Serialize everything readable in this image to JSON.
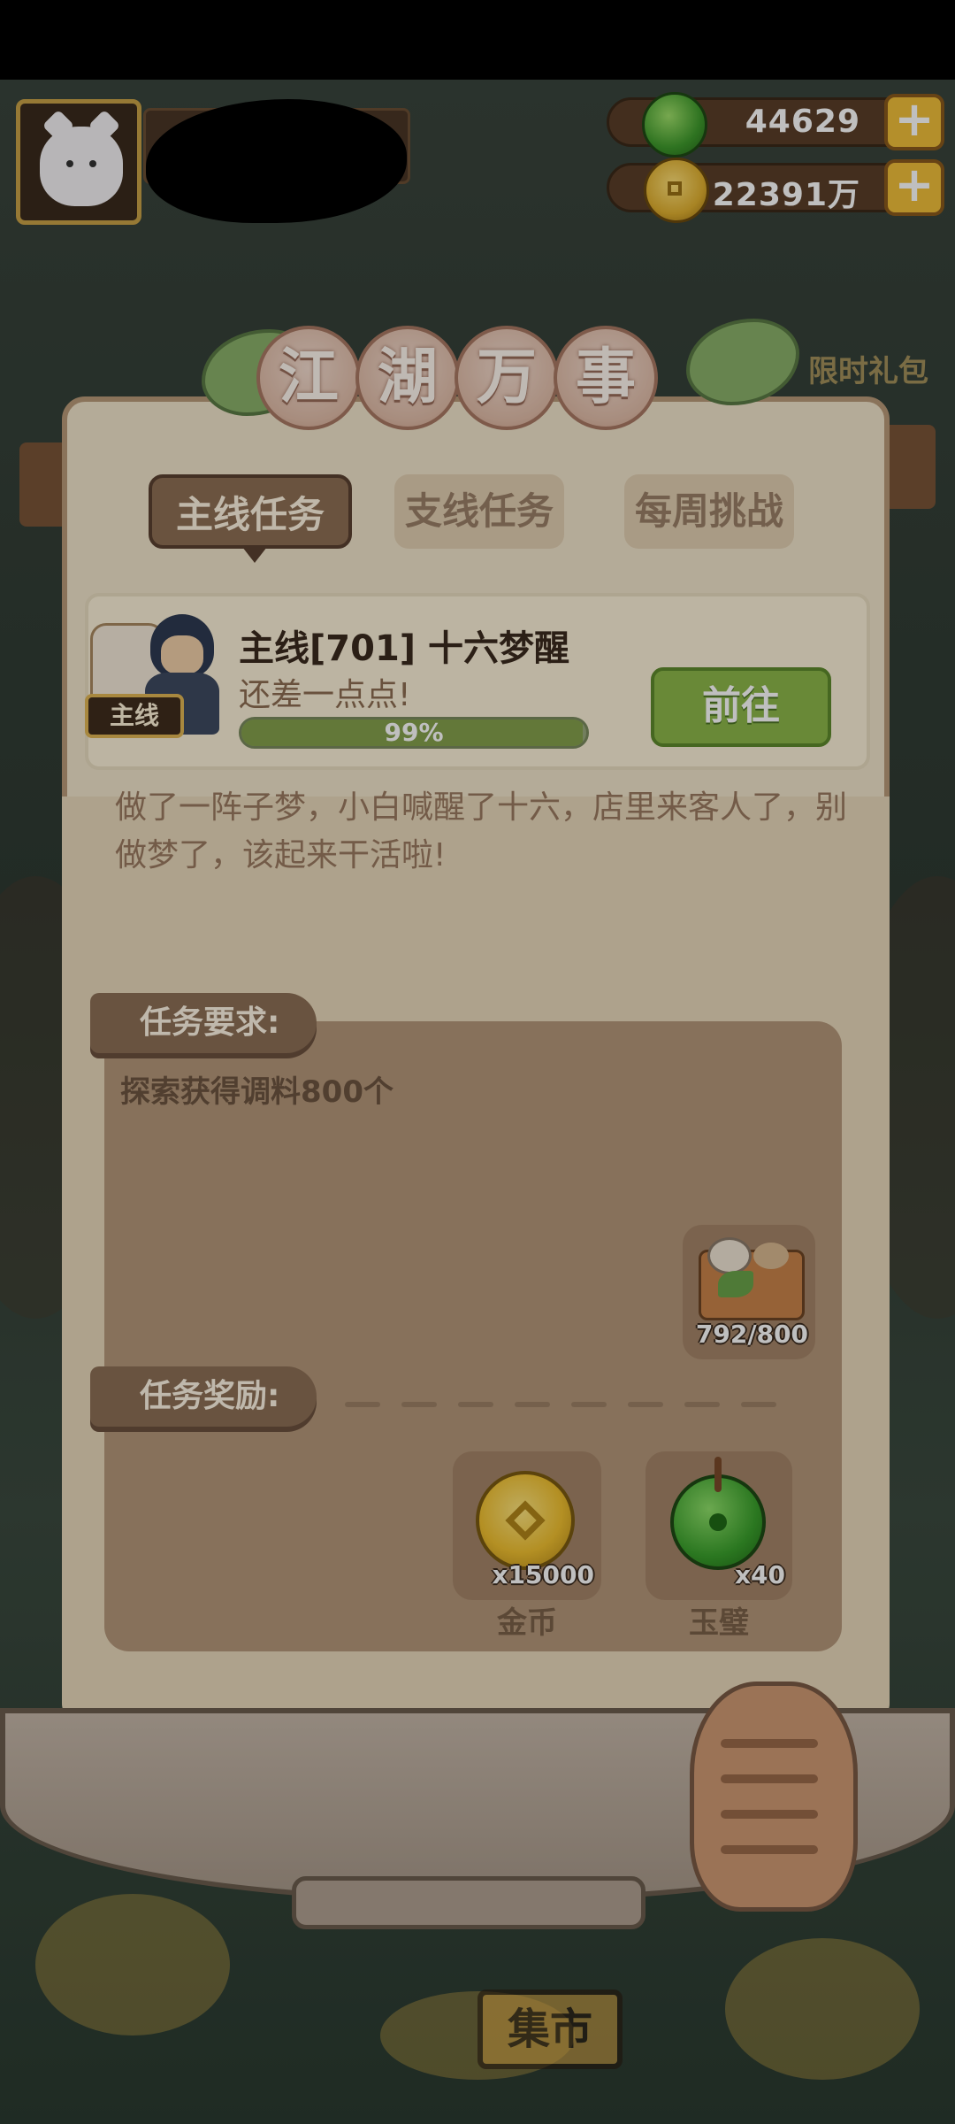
{
  "hud": {
    "jade_value": "44629",
    "coin_value": "22391万"
  },
  "panel": {
    "title_chars": [
      "江",
      "湖",
      "万",
      "事"
    ],
    "tabs": [
      {
        "label": "主线任务",
        "active": true
      },
      {
        "label": "支线任务",
        "active": false
      },
      {
        "label": "每周挑战",
        "active": false
      }
    ]
  },
  "quest": {
    "tag": "主线",
    "title": "主线[701] 十六梦醒",
    "subtitle": "还差一点点!",
    "progress_text": "99%",
    "progress": 0.99,
    "go_label": "前往",
    "description": "做了一阵子梦，小白喊醒了十六，店里来客人了，别做梦了，该起来干活啦!"
  },
  "requirements": {
    "label": "任务要求:",
    "text": "探索获得调料800个",
    "item_count": "792/800"
  },
  "rewards": {
    "label": "任务奖励:",
    "items": [
      {
        "count": "x15000",
        "name": "金币"
      },
      {
        "count": "x40",
        "name": "玉璧"
      }
    ]
  },
  "background": {
    "gift_label": "限时礼包",
    "market_label": "集市"
  },
  "colors": {
    "panel_bg": "#f1e4cb",
    "accent_green": "#8cb74a",
    "tab_active": "#8e6f54"
  }
}
